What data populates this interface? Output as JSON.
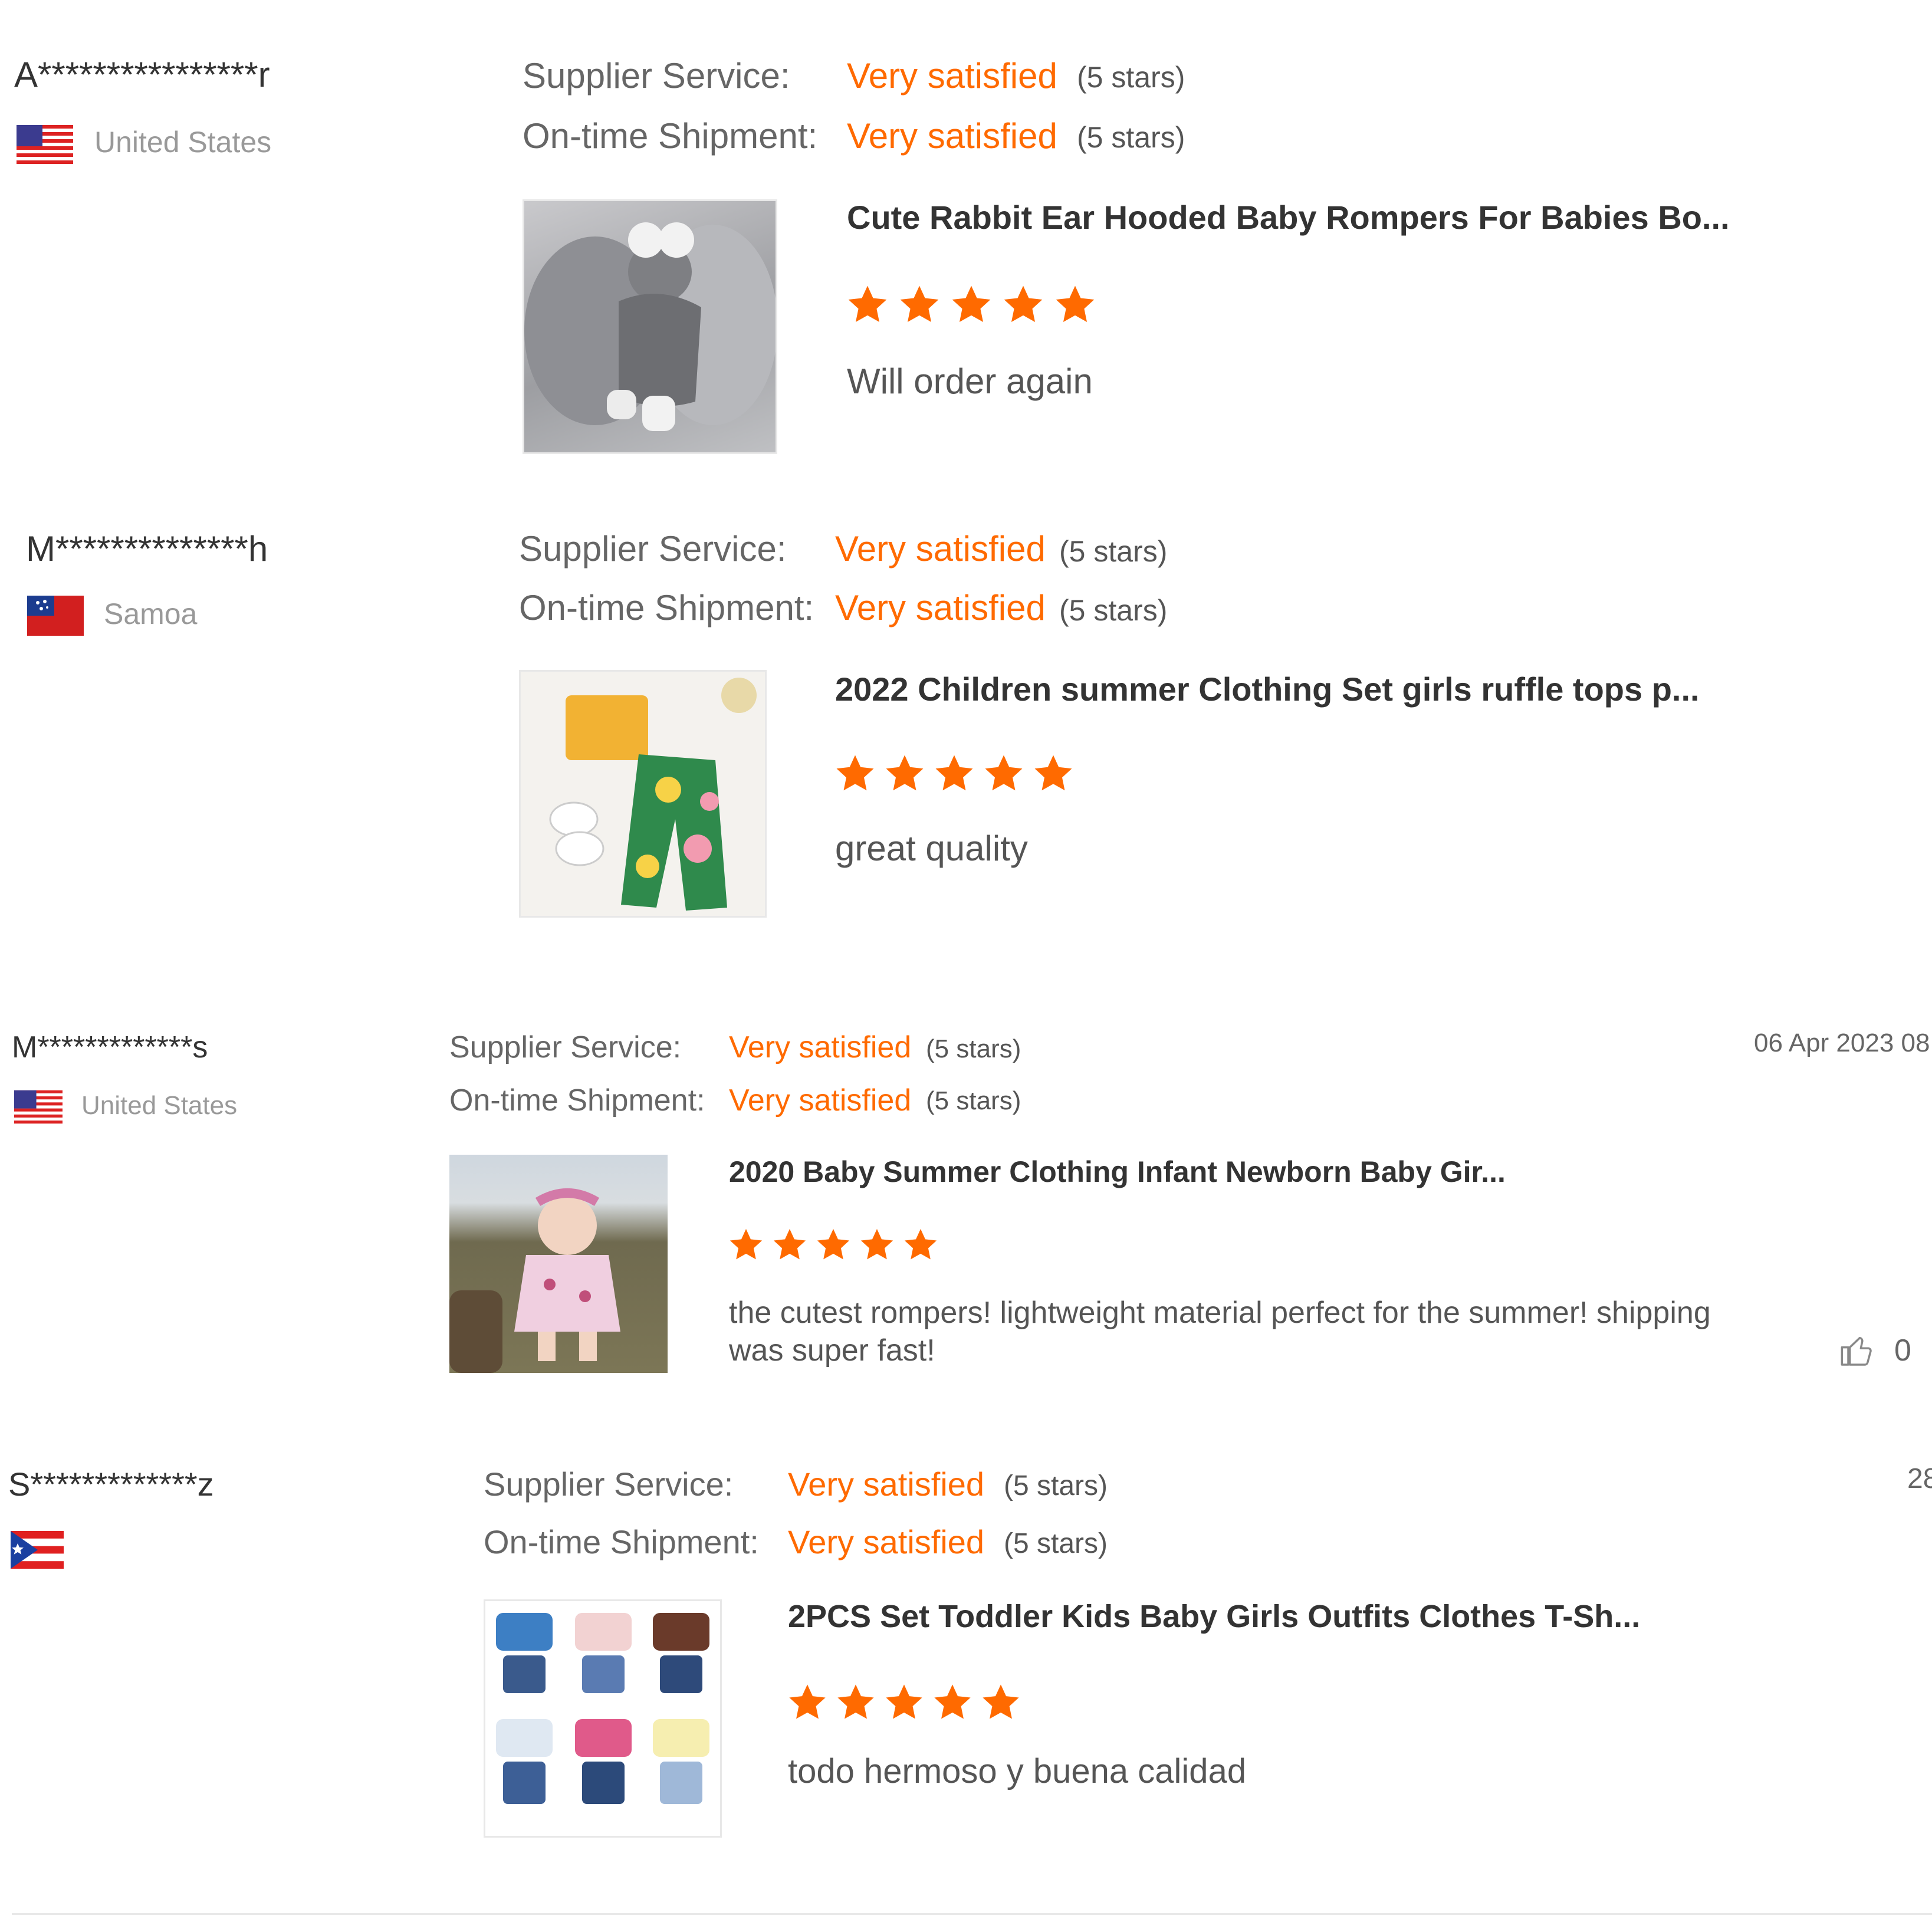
{
  "colors": {
    "accent": "#ff6a00",
    "text": "#333333",
    "muted": "#999999",
    "label": "#666666"
  },
  "reviews": [
    {
      "buyer": "A****************r",
      "country": "United States",
      "flag": "us-flag-icon",
      "supplier_label": "Supplier Service:",
      "supplier_value": "Very satisfied",
      "supplier_stars": "(5 stars)",
      "shipment_label": "On-time Shipment:",
      "shipment_value": "Very satisfied",
      "shipment_stars": "(5 stars)",
      "product_title": "Cute Rabbit Ear Hooded Baby Rompers For Babies Bo...",
      "rating": 5,
      "comment": "Will order again"
    },
    {
      "buyer": "M**************h",
      "country": "Samoa",
      "flag": "samoa-flag-icon",
      "supplier_label": "Supplier Service:",
      "supplier_value": "Very satisfied",
      "supplier_stars": "(5 stars)",
      "shipment_label": "On-time Shipment:",
      "shipment_value": "Very satisfied",
      "shipment_stars": "(5 stars)",
      "product_title": "2022 Children summer Clothing Set girls ruffle tops p...",
      "rating": 5,
      "comment": "great quality"
    },
    {
      "buyer": "M*************s",
      "country": "United States",
      "flag": "us-flag-icon",
      "supplier_label": "Supplier Service:",
      "supplier_value": "Very satisfied",
      "supplier_stars": "(5 stars)",
      "shipment_label": "On-time Shipment:",
      "shipment_value": "Very satisfied",
      "shipment_stars": "(5 stars)",
      "product_title": "2020 Baby Summer Clothing Infant Newborn Baby Gir...",
      "rating": 5,
      "comment_line1": "the cutest rompers! lightweight material perfect for the summer! shipping",
      "comment_line2": "was super fast!",
      "date": "06 Apr 2023 08:",
      "likes": "0"
    },
    {
      "buyer": "S*************z",
      "country": "",
      "flag": "puerto-rico-flag-icon",
      "supplier_label": "Supplier Service:",
      "supplier_value": "Very satisfied",
      "supplier_stars": "(5 stars)",
      "shipment_label": "On-time Shipment:",
      "shipment_value": "Very satisfied",
      "shipment_stars": "(5 stars)",
      "product_title": "2PCS Set Toddler Kids Baby Girls Outfits Clothes T-Sh...",
      "rating": 5,
      "comment": "todo hermoso y buena calidad",
      "date": "28"
    }
  ]
}
